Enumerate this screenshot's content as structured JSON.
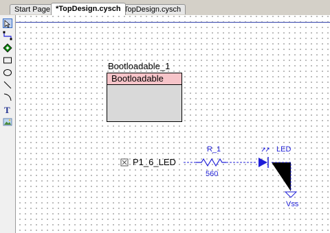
{
  "tabs": [
    {
      "label": "Start Page",
      "active": false
    },
    {
      "label": "*TopDesign.cysch",
      "active": true
    },
    {
      "label": "TopDesign.cysch",
      "active": false
    }
  ],
  "toolbox": [
    "pointer-icon",
    "wire-icon",
    "component-icon",
    "rectangle-icon",
    "ellipse-icon",
    "line-icon",
    "arc-icon",
    "text-icon",
    "image-icon"
  ],
  "schematic": {
    "component_instance": "Bootloadable_1",
    "component_name": "Bootloadable",
    "pin_label": "P1_6_LED",
    "resistor_name": "R_1",
    "resistor_value": "560",
    "led_name": "LED",
    "ground_name": "Vss"
  },
  "colors": {
    "wire": "#1f1fd8",
    "header_pink": "#f6c4c9",
    "selection_blue": "#2e3ea8"
  }
}
